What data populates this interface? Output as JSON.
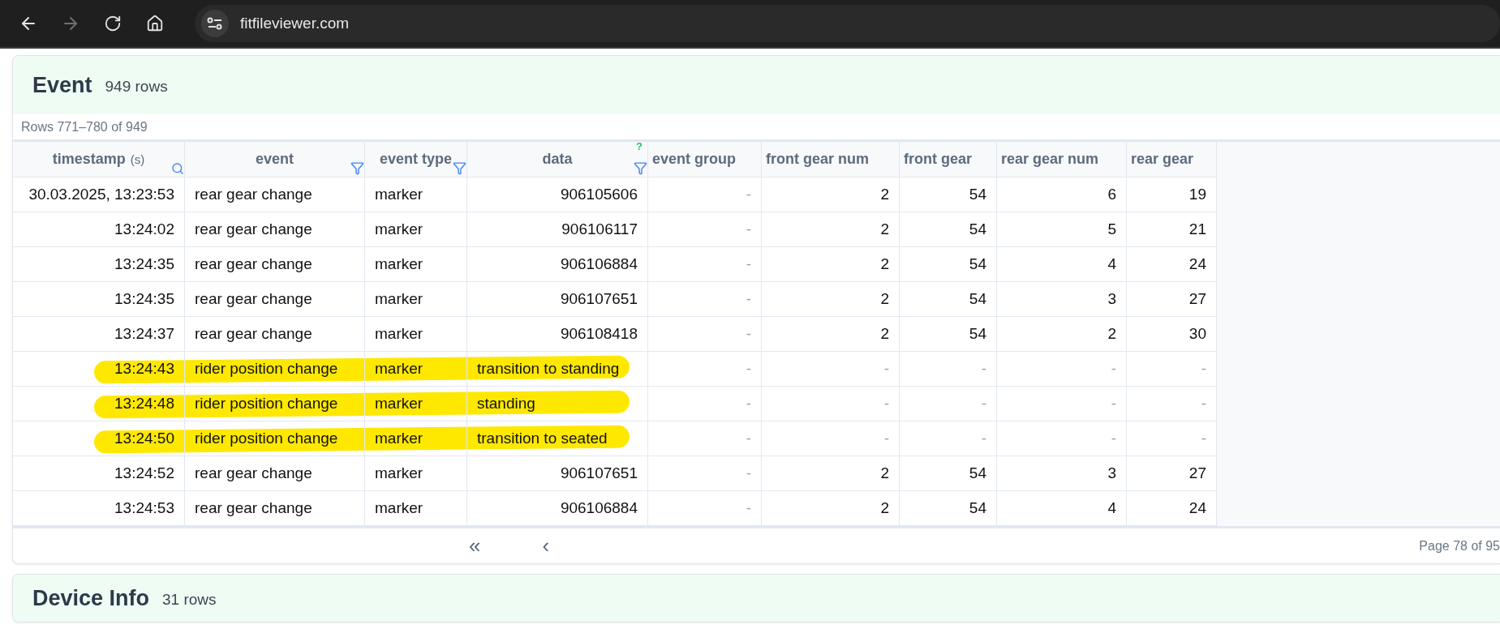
{
  "browser": {
    "url": "fitfileviewer.com"
  },
  "event_card": {
    "title": "Event",
    "count": "949 rows",
    "range": "Rows 771–780 of 949",
    "columns": [
      {
        "label": "timestamp",
        "unit": "(s)",
        "searchable": true
      },
      {
        "label": "event",
        "filterable": true
      },
      {
        "label": "event type",
        "filterable": true
      },
      {
        "label": "data",
        "filterable": true,
        "hint": "?"
      },
      {
        "label": "event group"
      },
      {
        "label": "front gear num"
      },
      {
        "label": "front gear"
      },
      {
        "label": "rear gear num"
      },
      {
        "label": "rear gear"
      }
    ],
    "rows": [
      {
        "highlighted": false,
        "numeric_data": true,
        "cells": [
          "30.03.2025, 13:23:53",
          "rear gear change",
          "marker",
          "906105606",
          {
            "text": "-",
            "empty": true
          },
          "2",
          "54",
          "6",
          "19"
        ]
      },
      {
        "highlighted": false,
        "numeric_data": true,
        "cells": [
          "13:24:02",
          "rear gear change",
          "marker",
          "906106117",
          {
            "text": "-",
            "empty": true
          },
          "2",
          "54",
          "5",
          "21"
        ]
      },
      {
        "highlighted": false,
        "numeric_data": true,
        "cells": [
          "13:24:35",
          "rear gear change",
          "marker",
          "906106884",
          {
            "text": "-",
            "empty": true
          },
          "2",
          "54",
          "4",
          "24"
        ]
      },
      {
        "highlighted": false,
        "numeric_data": true,
        "cells": [
          "13:24:35",
          "rear gear change",
          "marker",
          "906107651",
          {
            "text": "-",
            "empty": true
          },
          "2",
          "54",
          "3",
          "27"
        ]
      },
      {
        "highlighted": false,
        "numeric_data": true,
        "cells": [
          "13:24:37",
          "rear gear change",
          "marker",
          "906108418",
          {
            "text": "-",
            "empty": true
          },
          "2",
          "54",
          "2",
          "30"
        ]
      },
      {
        "highlighted": true,
        "numeric_data": false,
        "cells": [
          "13:24:43",
          "rider position change",
          "marker",
          "transition to standing",
          {
            "text": "-",
            "empty": true
          },
          {
            "text": "-",
            "empty": true
          },
          {
            "text": "-",
            "empty": true
          },
          {
            "text": "-",
            "empty": true
          },
          {
            "text": "-",
            "empty": true
          }
        ]
      },
      {
        "highlighted": true,
        "numeric_data": false,
        "cells": [
          "13:24:48",
          "rider position change",
          "marker",
          "standing",
          {
            "text": "-",
            "empty": true
          },
          {
            "text": "-",
            "empty": true
          },
          {
            "text": "-",
            "empty": true
          },
          {
            "text": "-",
            "empty": true
          },
          {
            "text": "-",
            "empty": true
          }
        ]
      },
      {
        "highlighted": true,
        "numeric_data": false,
        "cells": [
          "13:24:50",
          "rider position change",
          "marker",
          "transition to seated",
          {
            "text": "-",
            "empty": true
          },
          {
            "text": "-",
            "empty": true
          },
          {
            "text": "-",
            "empty": true
          },
          {
            "text": "-",
            "empty": true
          },
          {
            "text": "-",
            "empty": true
          }
        ]
      },
      {
        "highlighted": false,
        "numeric_data": true,
        "cells": [
          "13:24:52",
          "rear gear change",
          "marker",
          "906107651",
          {
            "text": "-",
            "empty": true
          },
          "2",
          "54",
          "3",
          "27"
        ]
      },
      {
        "highlighted": false,
        "numeric_data": true,
        "cells": [
          "13:24:53",
          "rear gear change",
          "marker",
          "906106884",
          {
            "text": "-",
            "empty": true
          },
          "2",
          "54",
          "4",
          "24"
        ]
      }
    ],
    "pager": {
      "first": "«",
      "prev": "‹",
      "page": "Page 78 of 95"
    }
  },
  "device_card": {
    "title": "Device Info",
    "count": "31 rows"
  }
}
